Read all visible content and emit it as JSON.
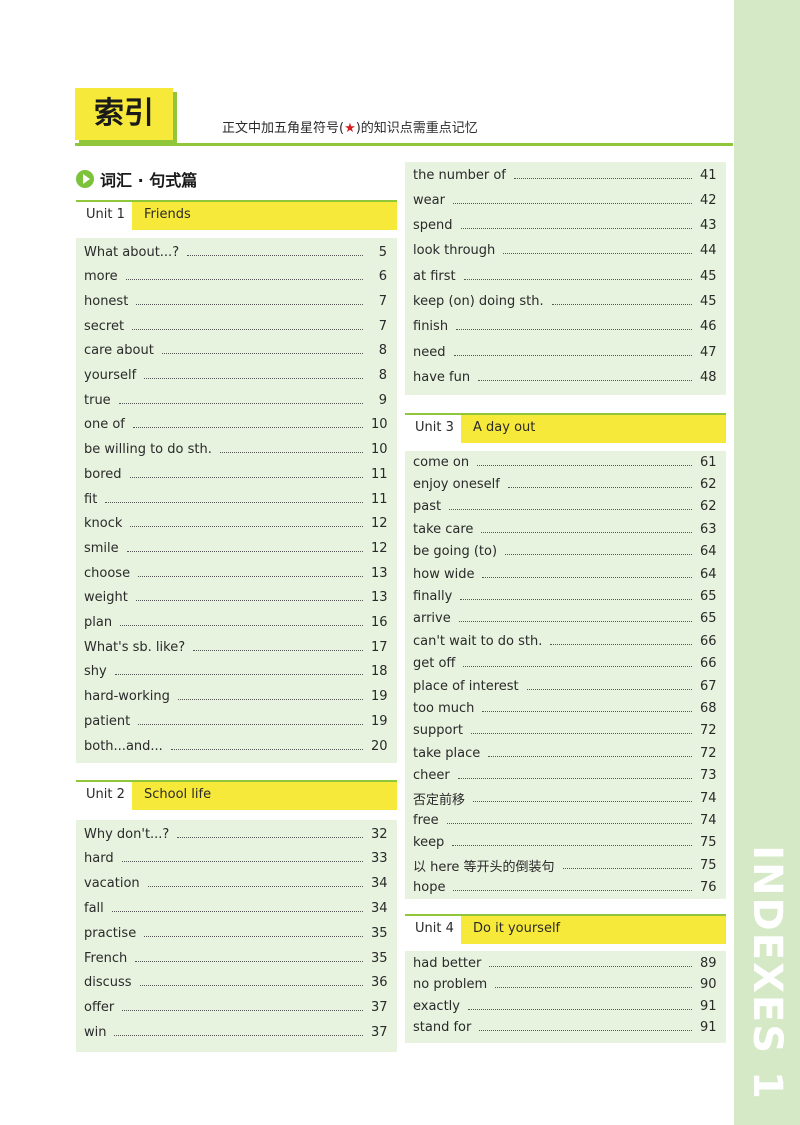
{
  "header": {
    "title": "索引",
    "note_before": "正文中加五角星符号(",
    "note_star": "★",
    "note_after": ")的知识点需重点记忆"
  },
  "section": {
    "label": "词汇 · 句式篇",
    "icon": "play-icon"
  },
  "side_label": "INDEXES 1",
  "units": [
    {
      "num": "Unit 1",
      "name": "Friends",
      "entries": [
        {
          "term": "What about...?",
          "page": "5"
        },
        {
          "term": "more",
          "page": "6"
        },
        {
          "term": "honest",
          "page": "7"
        },
        {
          "term": "secret",
          "page": "7"
        },
        {
          "term": "care about",
          "page": "8"
        },
        {
          "term": "yourself",
          "page": "8"
        },
        {
          "term": "true",
          "page": "9"
        },
        {
          "term": "one of",
          "page": "10"
        },
        {
          "term": "be willing to do sth.",
          "page": "10"
        },
        {
          "term": "bored",
          "page": "11"
        },
        {
          "term": "fit",
          "page": "11"
        },
        {
          "term": "knock",
          "page": "12"
        },
        {
          "term": "smile",
          "page": "12"
        },
        {
          "term": "choose",
          "page": "13"
        },
        {
          "term": "weight",
          "page": "13"
        },
        {
          "term": "plan",
          "page": "16"
        },
        {
          "term": "What's sb. like?",
          "page": "17"
        },
        {
          "term": "shy",
          "page": "18"
        },
        {
          "term": "hard-working",
          "page": "19"
        },
        {
          "term": "patient",
          "page": "19"
        },
        {
          "term": "both...and...",
          "page": "20"
        }
      ]
    },
    {
      "num": "Unit 2",
      "name": "School life",
      "entries": [
        {
          "term": "Why don't...?",
          "page": "32"
        },
        {
          "term": "hard",
          "page": "33"
        },
        {
          "term": "vacation",
          "page": "34"
        },
        {
          "term": "fall",
          "page": "34"
        },
        {
          "term": "practise",
          "page": "35"
        },
        {
          "term": "French",
          "page": "35"
        },
        {
          "term": "discuss",
          "page": "36"
        },
        {
          "term": "offer",
          "page": "37"
        },
        {
          "term": "win",
          "page": "37"
        }
      ],
      "continued": [
        {
          "term": "the number of",
          "page": "41"
        },
        {
          "term": "wear",
          "page": "42"
        },
        {
          "term": "spend",
          "page": "43"
        },
        {
          "term": "look through",
          "page": "44"
        },
        {
          "term": "at first",
          "page": "45"
        },
        {
          "term": "keep (on) doing sth.",
          "page": "45"
        },
        {
          "term": "finish",
          "page": "46"
        },
        {
          "term": "need",
          "page": "47"
        },
        {
          "term": "have fun",
          "page": "48"
        }
      ]
    },
    {
      "num": "Unit 3",
      "name": "A day out",
      "entries": [
        {
          "term": "come on",
          "page": "61"
        },
        {
          "term": "enjoy oneself",
          "page": "62"
        },
        {
          "term": "past",
          "page": "62"
        },
        {
          "term": "take care",
          "page": "63"
        },
        {
          "term": "be going (to)",
          "page": "64"
        },
        {
          "term": "how wide",
          "page": "64"
        },
        {
          "term": "finally",
          "page": "65"
        },
        {
          "term": "arrive",
          "page": "65"
        },
        {
          "term": "can't wait to do sth.",
          "page": "66"
        },
        {
          "term": "get off",
          "page": "66"
        },
        {
          "term": "place of interest",
          "page": "67"
        },
        {
          "term": "too much",
          "page": "68"
        },
        {
          "term": "support",
          "page": "72"
        },
        {
          "term": "take place",
          "page": "72"
        },
        {
          "term": "cheer",
          "page": "73"
        },
        {
          "term": "否定前移",
          "page": "74"
        },
        {
          "term": "free",
          "page": "74"
        },
        {
          "term": "keep",
          "page": "75"
        },
        {
          "term": "以 here 等开头的倒装句",
          "page": "75"
        },
        {
          "term": "hope",
          "page": "76"
        }
      ]
    },
    {
      "num": "Unit 4",
      "name": "Do it yourself",
      "entries": [
        {
          "term": "had better",
          "page": "89"
        },
        {
          "term": "no problem",
          "page": "90"
        },
        {
          "term": "exactly",
          "page": "91"
        },
        {
          "term": "stand for",
          "page": "91"
        }
      ]
    }
  ],
  "colors": {
    "accent_yellow": "#f7e93a",
    "accent_green": "#8fc63a",
    "box_bg": "#e7f2df",
    "side_strip": "#d6e9c6"
  }
}
